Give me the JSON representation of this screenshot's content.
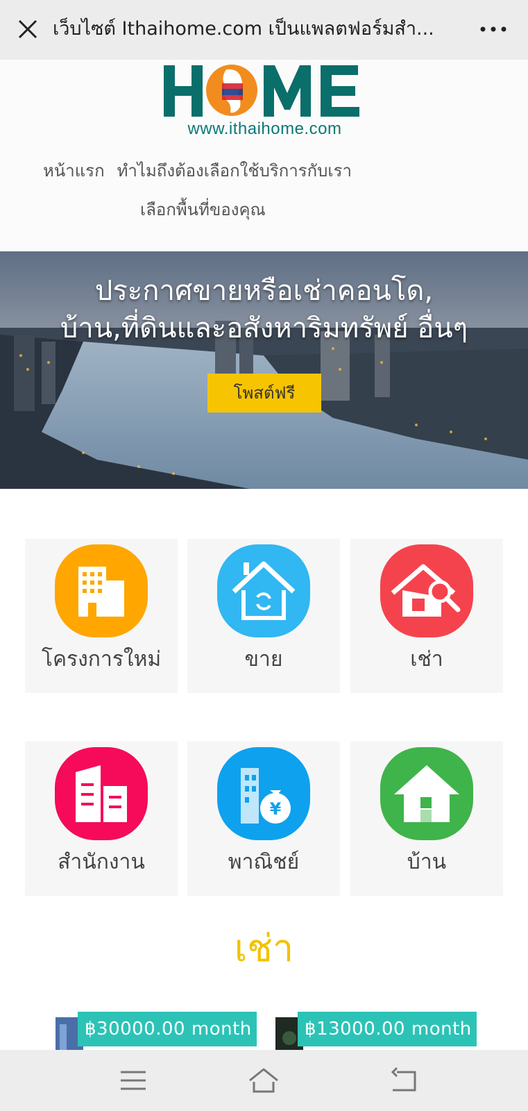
{
  "browser": {
    "title": "เว็บไซต์ Ithaihome.com เป็นแพลตฟอร์มสำ...",
    "close_icon": "close-icon",
    "more_icon": "more-dots-icon"
  },
  "header": {
    "logo_text": "HOME",
    "logo_url": "www.ithaihome.com",
    "nav": [
      "หน้าแรก",
      "ทำไมถึงต้องเลือกใช้บริการกับเรา",
      "เลือกพื้นที่ของคุณ"
    ]
  },
  "hero": {
    "headline_line1": "ประกาศขายหรือเช่าคอนโด,",
    "headline_line2": "บ้าน,ที่ดินและอสังหาริมทรัพย์ อื่นๆ",
    "cta_label": "โพสต์ฟรี"
  },
  "categories": [
    {
      "label": "โครงการใหม่",
      "icon": "building-icon",
      "color": "#ffa600"
    },
    {
      "label": "ขาย",
      "icon": "house-sale-icon",
      "color": "#31b7f2"
    },
    {
      "label": "เช่า",
      "icon": "house-search-icon",
      "color": "#f5434d"
    },
    {
      "label": "สำนักงาน",
      "icon": "office-icon",
      "color": "#f50b59"
    },
    {
      "label": "พาณิชย์",
      "icon": "commercial-money-icon",
      "color": "#0ea1ee"
    },
    {
      "label": "บ้าน",
      "icon": "home-icon",
      "color": "#3fb44a"
    }
  ],
  "section": {
    "title": "เช่า"
  },
  "listings": [
    {
      "price": "฿30000.00 month"
    },
    {
      "price": "฿13000.00 month"
    }
  ],
  "bottom_nav": {
    "menu_icon": "menu-icon",
    "home_icon": "home-outline-icon",
    "back_icon": "back-icon"
  },
  "colors": {
    "logo_teal": "#0a6e6b",
    "logo_orange": "#f28c1e",
    "cta_yellow": "#f6c400",
    "price_badge": "#2cc3b6",
    "section_title": "#f2c200"
  }
}
